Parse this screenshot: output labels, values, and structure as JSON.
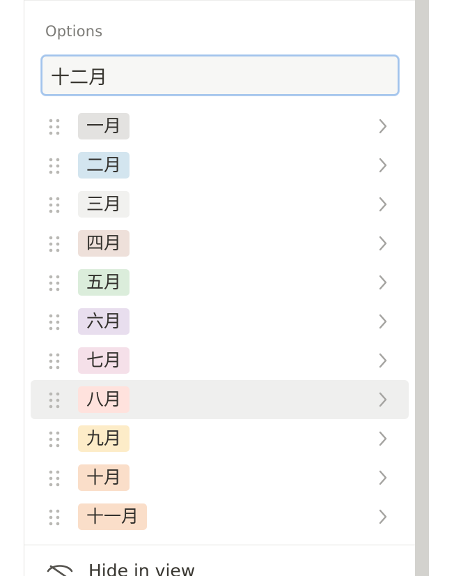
{
  "options_section": {
    "label": "Options",
    "input_value": "十二月"
  },
  "options": [
    {
      "label": "一月",
      "color": "#e3e2e0"
    },
    {
      "label": "二月",
      "color": "#d3e5ef"
    },
    {
      "label": "三月",
      "color": "#f1f1ef"
    },
    {
      "label": "四月",
      "color": "#eee0da"
    },
    {
      "label": "五月",
      "color": "#dbeddb"
    },
    {
      "label": "六月",
      "color": "#e8deee"
    },
    {
      "label": "七月",
      "color": "#f5e0e9"
    },
    {
      "label": "八月",
      "color": "#ffe2dd"
    },
    {
      "label": "九月",
      "color": "#fdecc8"
    },
    {
      "label": "十月",
      "color": "#fadec9"
    },
    {
      "label": "十一月",
      "color": "#fadec9"
    }
  ],
  "hovered_option": "八月",
  "footer": {
    "hide_label": "Hide in view",
    "hide_icon": "eye-slash-icon"
  }
}
